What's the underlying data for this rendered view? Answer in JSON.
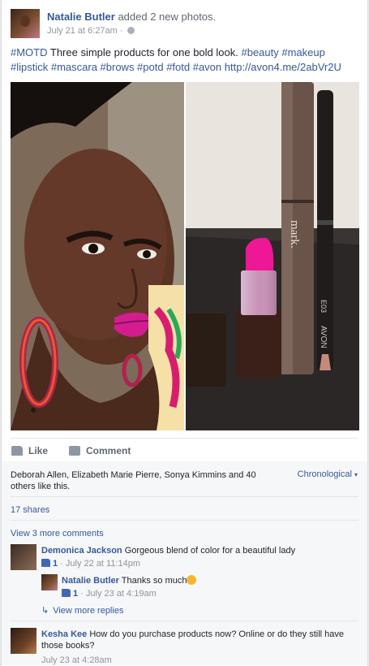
{
  "post": {
    "author": "Natalie Butler",
    "action": "added 2 new photos.",
    "timestamp": "July 21 at 6:27am",
    "separator": "·",
    "text_hashtag_motd": "#MOTD",
    "text_body": "Three simple products for one bold look.",
    "text_tags_line1": "#beauty #makeup",
    "text_tags_line2": "#lipstick #mascara #brows #potd #fotd #avon",
    "text_link": "http://avon4.me/2abVr2U"
  },
  "photos": {
    "right_brand": "mark.",
    "right_pencil_brand": "AVON",
    "right_pencil_code": "E03"
  },
  "actions": {
    "like_label": "Like",
    "comment_label": "Comment"
  },
  "summary": {
    "likes_text": "Deborah Allen, Elizabeth Marie Pierre, Sonya Kimmins and 40 others like this.",
    "sort_label": "Chronological",
    "shares": "17 shares",
    "view_more_comments": "View 3 more comments"
  },
  "comments": [
    {
      "name": "Demonica Jackson",
      "text": "Gorgeous blend of color for a beautiful lady",
      "likes": "1",
      "time": "July 22 at 11:14pm"
    },
    {
      "name": "Natalie Butler",
      "text": "Thanks so much",
      "likes": "1",
      "time": "July 23 at 4:19am"
    },
    {
      "name": "Kesha Kee",
      "text": "How do you purchase products now? Online or do they still have those books?",
      "time": "July 23 at 4:28am"
    }
  ],
  "view_more_replies": "View more replies",
  "icons": {
    "globe": "globe-icon",
    "like": "thumbs-up-icon",
    "comment": "speech-bubble-icon",
    "reply": "reply-arrow-icon",
    "emoji": "wink-emoji-icon"
  },
  "colors": {
    "link": "#365899",
    "text": "#1d2129",
    "muted": "#90949c",
    "background": "#e9ebee",
    "summary_bg": "#f6f7f9"
  }
}
